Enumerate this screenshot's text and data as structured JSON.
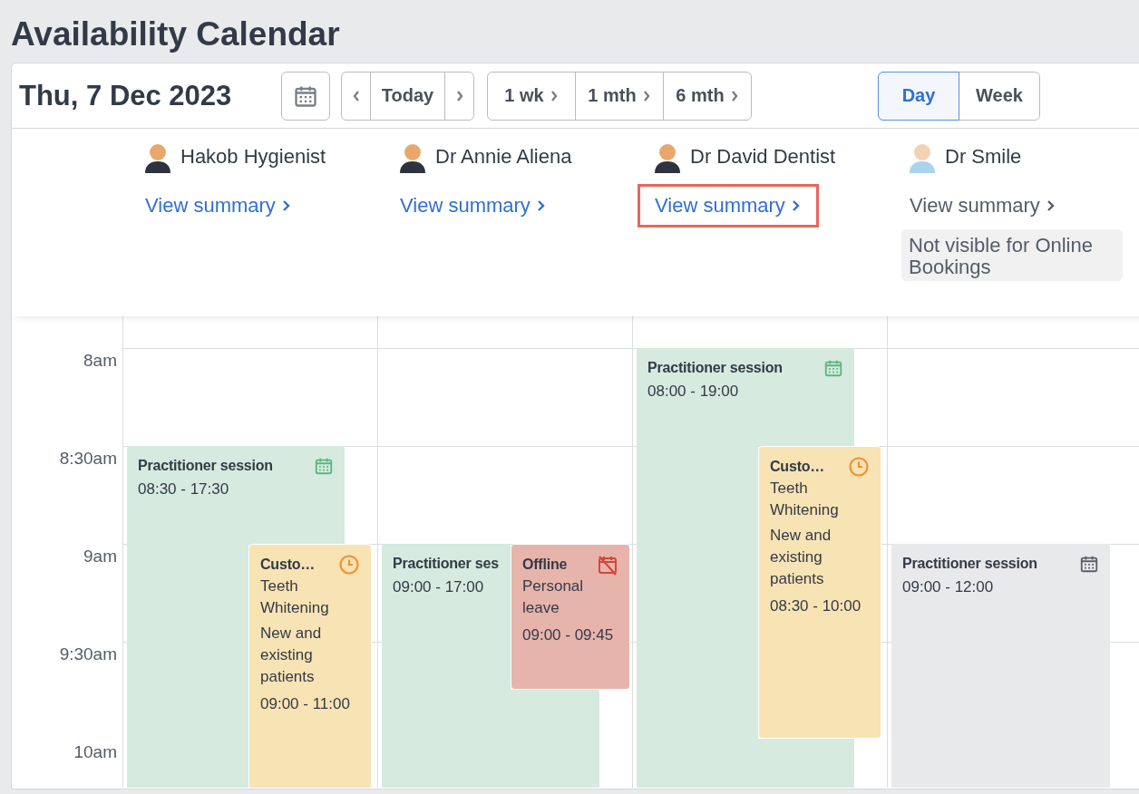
{
  "page_title": "Availability Calendar",
  "toolbar": {
    "date": "Thu, 7 Dec 2023",
    "today": "Today",
    "ranges": [
      "1 wk",
      "1 mth",
      "6 mth"
    ],
    "views": [
      {
        "label": "Day",
        "selected": true
      },
      {
        "label": "Week",
        "selected": false
      }
    ]
  },
  "practitioners": [
    {
      "name": "Hakob Hygienist",
      "link": "View summary",
      "online_visible": true,
      "highlighted": false,
      "events": [
        {
          "kind": "session",
          "title": "Practitioner session",
          "time": "08:30 - 17:30"
        },
        {
          "kind": "appointment",
          "title": "Custo…",
          "lines": [
            "Teeth Whitening",
            "New and existing patients"
          ],
          "time": "09:00 - 11:00"
        }
      ]
    },
    {
      "name": "Dr Annie Aliena",
      "link": "View summary",
      "online_visible": true,
      "highlighted": false,
      "events": [
        {
          "kind": "session",
          "title": "Practitioner ses",
          "time": "09:00 - 17:00"
        },
        {
          "kind": "offline",
          "title": "Offline",
          "lines": [
            "Personal leave"
          ],
          "time": "09:00 - 09:45"
        }
      ]
    },
    {
      "name": "Dr David Dentist",
      "link": "View summary",
      "online_visible": true,
      "highlighted": true,
      "events": [
        {
          "kind": "session",
          "title": "Practitioner session",
          "time": "08:00 - 19:00"
        },
        {
          "kind": "appointment",
          "title": "Custo…",
          "lines": [
            "Teeth Whitening",
            "New and existing patients"
          ],
          "time": "08:30 - 10:00"
        }
      ]
    },
    {
      "name": "Dr Smile",
      "link": "View summary",
      "online_visible": false,
      "highlighted": false,
      "badge": "Not visible for Online Bookings",
      "events": [
        {
          "kind": "session",
          "title": "Practitioner session",
          "time": "09:00 - 12:00"
        }
      ]
    }
  ],
  "time_labels": [
    "8am",
    "8:30am",
    "9am",
    "9:30am",
    "10am"
  ]
}
